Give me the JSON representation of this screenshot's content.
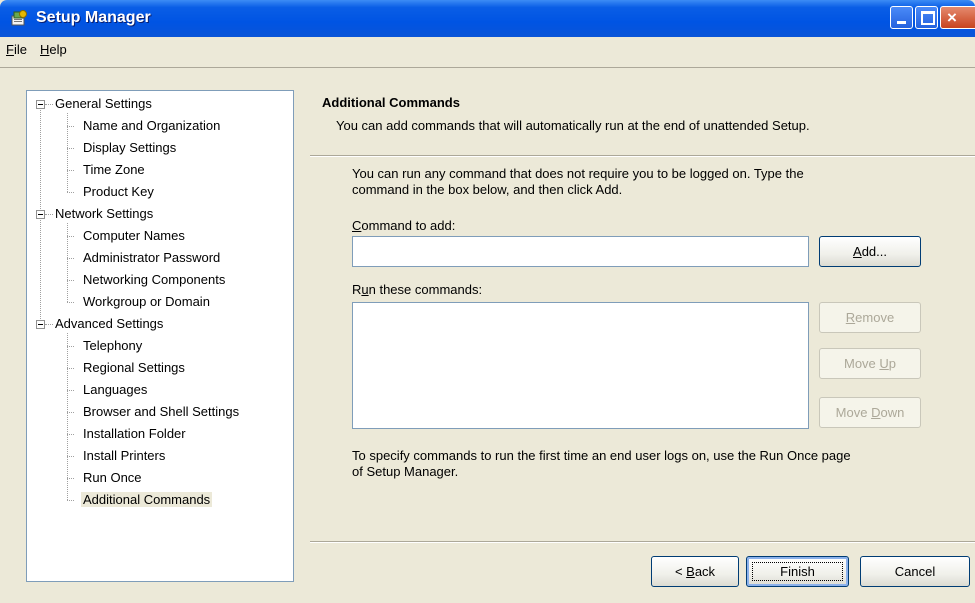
{
  "window": {
    "title": "Setup Manager",
    "icon": "setup-manager-icon",
    "controls": [
      "minimize",
      "maximize",
      "close"
    ]
  },
  "menu": {
    "file": {
      "acc": "F",
      "rest": "ile"
    },
    "help": {
      "acc": "H",
      "rest": "elp"
    }
  },
  "tree": {
    "general": {
      "label": "General Settings",
      "items": [
        "Name and Organization",
        "Display Settings",
        "Time Zone",
        "Product Key"
      ]
    },
    "network": {
      "label": "Network Settings",
      "items": [
        "Computer Names",
        "Administrator Password",
        "Networking Components",
        "Workgroup or Domain"
      ]
    },
    "advanced": {
      "label": "Advanced Settings",
      "items": [
        "Telephony",
        "Regional Settings",
        "Languages",
        "Browser and Shell Settings",
        "Installation Folder",
        "Install Printers",
        "Run Once",
        "Additional Commands"
      ]
    },
    "selected": "Additional Commands"
  },
  "page": {
    "title": "Additional Commands",
    "subtitle": "You can add commands that will automatically run at the end of unattended Setup.",
    "intro_line1": "You can run any command that does not require you to be logged on. Type the",
    "intro_line2": "command in the box below, and then click Add.",
    "command_label": {
      "acc": "C",
      "rest": "ommand to add:"
    },
    "command_value": "",
    "run_label": {
      "pre": "R",
      "acc": "u",
      "rest": "n these commands:"
    },
    "run_list": [],
    "footer_line1": "To specify commands to run the first time an end user logs on, use the Run Once page",
    "footer_line2": "of Setup Manager."
  },
  "buttons": {
    "add": {
      "acc": "A",
      "rest": "dd..."
    },
    "remove": {
      "acc": "R",
      "rest": "emove"
    },
    "move_up": {
      "pre": "Move ",
      "acc": "U",
      "rest": "p"
    },
    "move_down": {
      "pre": "Move ",
      "acc": "D",
      "rest": "own"
    },
    "back": {
      "pre": "< ",
      "acc": "B",
      "rest": "ack"
    },
    "finish": "Finish",
    "cancel": "Cancel"
  }
}
